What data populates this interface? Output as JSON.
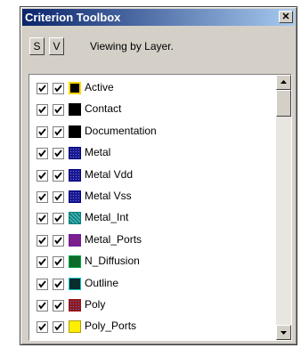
{
  "window": {
    "title": "Criterion Toolbox",
    "close_label": "✕"
  },
  "toolbar": {
    "s_label": "S",
    "v_label": "V",
    "viewing_text": "Viewing by Layer."
  },
  "layers": [
    {
      "name": "Active",
      "swatch": "#000000",
      "border": "#ffd700",
      "pattern": "solid"
    },
    {
      "name": "Contact",
      "swatch": "#000000",
      "border": "#000000",
      "pattern": "solid"
    },
    {
      "name": "Documentation",
      "swatch": "#000000",
      "border": "#000000",
      "pattern": "solid"
    },
    {
      "name": "Metal",
      "swatch": "#1a1a8c",
      "border": "#000080",
      "pattern": "dots"
    },
    {
      "name": "Metal Vdd",
      "swatch": "#1a1a8c",
      "border": "#000080",
      "pattern": "dots"
    },
    {
      "name": "Metal Vss",
      "swatch": "#1a1a8c",
      "border": "#000080",
      "pattern": "dots"
    },
    {
      "name": "Metal_Int",
      "swatch": "#1f7a7a",
      "border": "#008080",
      "pattern": "hatch"
    },
    {
      "name": "Metal_Ports",
      "swatch": "#7a1f8c",
      "border": "#6a1b9a",
      "pattern": "solid"
    },
    {
      "name": "N_Diffusion",
      "swatch": "#0b6b2a",
      "border": "#00a040",
      "pattern": "solid"
    },
    {
      "name": "Outline",
      "swatch": "#0b2c2c",
      "border": "#00c8c8",
      "pattern": "solid"
    },
    {
      "name": "Poly",
      "swatch": "#8c1a1a",
      "border": "#a01010",
      "pattern": "dots"
    },
    {
      "name": "Poly_Ports",
      "swatch": "#ffee00",
      "border": "#b0a000",
      "pattern": "solid"
    }
  ]
}
